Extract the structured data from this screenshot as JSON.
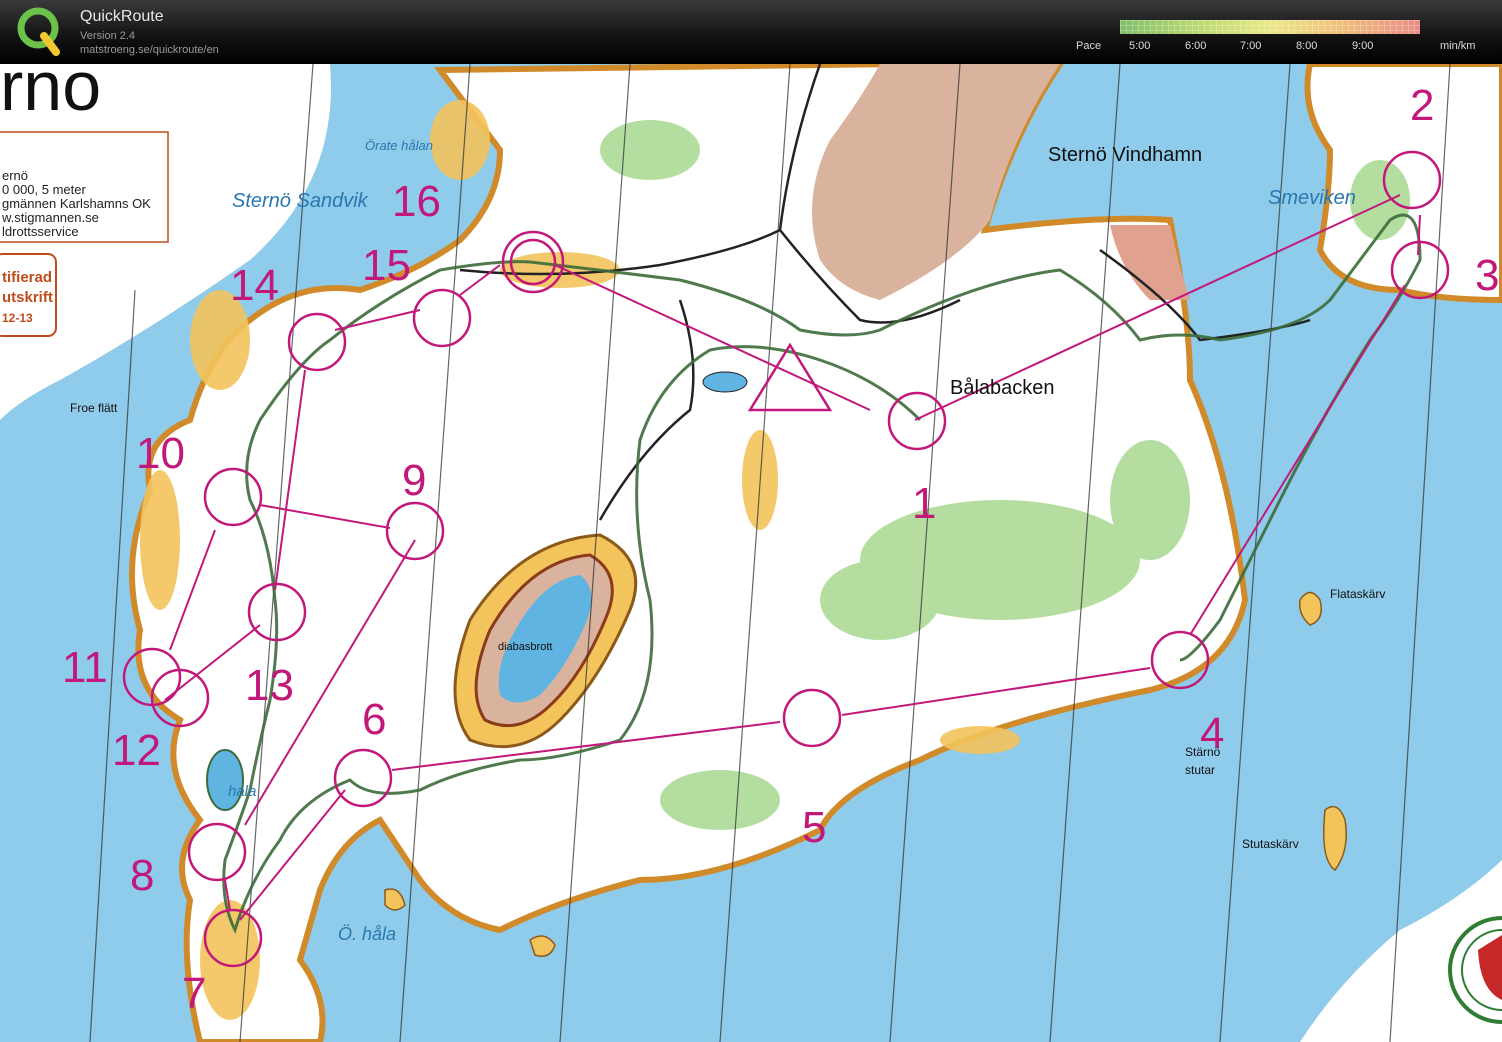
{
  "app": {
    "name": "QuickRoute",
    "version": "Version 2.4",
    "url": "matstroeng.se/quickroute/en"
  },
  "pace_legend": {
    "label": "Pace",
    "ticks": [
      "5:00",
      "6:00",
      "7:00",
      "8:00",
      "9:00"
    ],
    "unit": "min/km",
    "colors": [
      "#7fbf6a",
      "#b9d870",
      "#e9e886",
      "#f0c27a",
      "#e98c84"
    ]
  },
  "map": {
    "title_fragment": "rno",
    "info_box": {
      "lines": [
        "ernö",
        "0 000, 5 meter",
        "gmännen Karlshamns OK",
        "w.stigmannen.se",
        "ldrottsservice"
      ]
    },
    "cert_box": {
      "lines": [
        "tifierad",
        "utskrift",
        "12-13"
      ]
    },
    "place_names": {
      "orate_halan": "Örate hålan",
      "sandvik": "Sternö Sandvik",
      "vindhamn": "Sternö Vindhamn",
      "smeviken": "Smeviken",
      "balabacken": "Bålabacken",
      "froe_flatt": "Froe flätt",
      "diabasbrott": "diabasbrott",
      "flataskarv": "Flataskärv",
      "sterno": "Stärnö",
      "stutar": "stutar",
      "stutaskarv": "Stutaskärv",
      "o_hala": "Ö. håla",
      "v_hala": "hala"
    },
    "control_numbers": [
      "1",
      "2",
      "3",
      "4",
      "5",
      "6",
      "7",
      "8",
      "9",
      "10",
      "11",
      "12",
      "13",
      "14",
      "15",
      "16"
    ],
    "colors": {
      "water": "#8fcbea",
      "land": "#ffffff",
      "open_land": "#f3c35c",
      "vegetation": "#a7d88f",
      "paved": "#d9b39d",
      "course": "#c2187a",
      "route": "#3d6b3a"
    }
  }
}
